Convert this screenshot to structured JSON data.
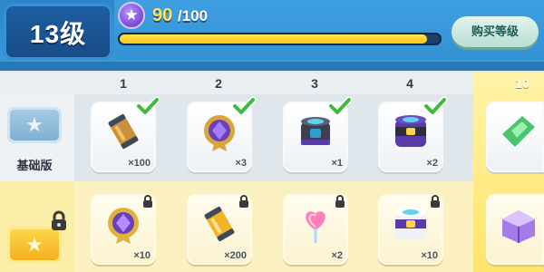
{
  "header": {
    "level_label": "13级",
    "xp_current": "90",
    "xp_separator_max": "/100",
    "xp_progress": 0.96,
    "buy_level_label": "购买等级",
    "star_icon": "star-icon"
  },
  "columns": [
    "1",
    "2",
    "3",
    "4",
    "10"
  ],
  "rows": {
    "basic": {
      "label": "基础版",
      "icon": "star-ticket-icon"
    },
    "premium": {
      "label": "",
      "icon": "star-ticket-gold-icon",
      "locked": true
    }
  },
  "basic_rewards": [
    {
      "name": "can-item",
      "qty": "×100",
      "claimed": true
    },
    {
      "name": "purple-medal-item",
      "qty": "×3",
      "claimed": true
    },
    {
      "name": "capsule-item",
      "qty": "×1",
      "claimed": true
    },
    {
      "name": "big-capsule-item",
      "qty": "×2",
      "claimed": true
    },
    {
      "name": "green-gem-item",
      "qty": "",
      "claimed": false
    }
  ],
  "premium_rewards": [
    {
      "name": "purple-medal-item",
      "qty": "×10",
      "locked": true
    },
    {
      "name": "gold-can-item",
      "qty": "×200",
      "locked": true
    },
    {
      "name": "heart-lollipop-item",
      "qty": "×2",
      "locked": true
    },
    {
      "name": "white-capsule-item",
      "qty": "×10",
      "locked": true
    },
    {
      "name": "purple-crate-item",
      "qty": "",
      "locked": false
    }
  ],
  "colors": {
    "header_blue": "#3b9bdc",
    "xp_yellow": "#ffc716",
    "check_green": "#3dbb3d",
    "premium_gold": "#ffd84c",
    "star_purple": "#7a4ad6"
  }
}
